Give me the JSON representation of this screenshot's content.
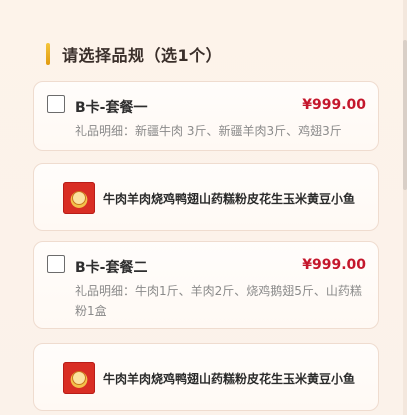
{
  "section": {
    "title": "请选择品规（选1个）"
  },
  "packages": [
    {
      "name": "B卡-套餐一",
      "price": "¥999.00",
      "detail": "礼品明细：新疆牛肉 3斤、新疆羊肉3斤、鸡翅3斤"
    },
    {
      "name": "B卡-套餐二",
      "price": "¥999.00",
      "detail": "礼品明细：牛肉1斤、羊肉2斤、烧鸡鹅翅5斤、山药糕粉1盒"
    }
  ],
  "products": [
    {
      "name": "牛肉羊肉烧鸡鸭翅山药糕粉皮花生玉米黄豆小鱼"
    },
    {
      "name": "牛肉羊肉烧鸡鸭翅山药糕粉皮花生玉米黄豆小鱼"
    }
  ],
  "colors": {
    "accent": "#f4c53b",
    "price": "#c4172c",
    "border": "#efdccf"
  }
}
